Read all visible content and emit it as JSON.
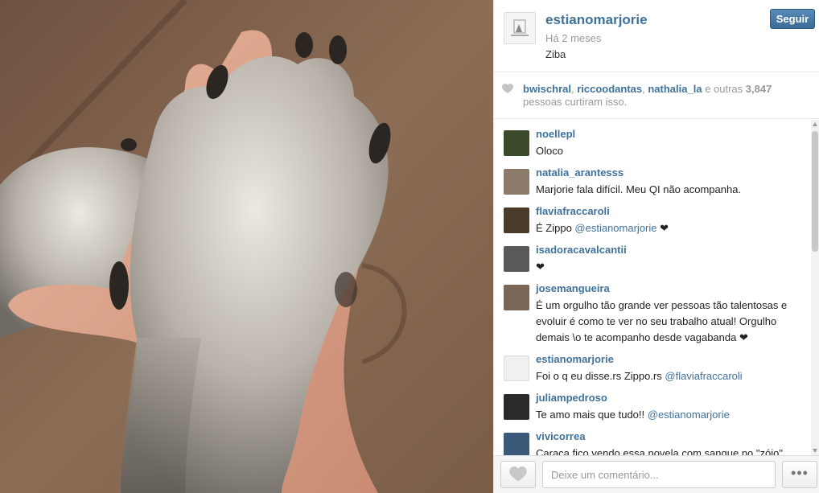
{
  "post": {
    "username": "estianomarjorie",
    "time": "Há 2 meses",
    "caption": "Ziba",
    "follow_label": "Seguir"
  },
  "likes": {
    "users": [
      "bwischral",
      "riccoodantas",
      "nathalia_la"
    ],
    "connector": "e outras",
    "count": "3,847",
    "suffix": "pessoas curtiram isso."
  },
  "comments": [
    {
      "user": "noellepl",
      "text": "Oloco ",
      "mention": "",
      "after": "",
      "avatar_color": "#3c4a2c"
    },
    {
      "user": "natalia_arantesss",
      "text": "Marjorie fala difícil. Meu QI não acompanha. ",
      "mention": "",
      "after": "",
      "avatar_color": "#8c7a6a"
    },
    {
      "user": "flaviafraccaroli",
      "text": "É Zippo ",
      "mention": "@estianomarjorie",
      "after": " ❤",
      "avatar_color": "#4a3b2a"
    },
    {
      "user": "isadoracavalcantii",
      "text": "❤",
      "mention": "",
      "after": "",
      "avatar_color": "#5a5a5a"
    },
    {
      "user": "josemangueira",
      "text": "É um orgulho tão grande ver pessoas tão talentosas e evoluir é como te ver no seu trabalho atual! Orgulho demais \\o te acompanho desde vagabanda ❤",
      "mention": "",
      "after": "",
      "avatar_color": "#7a6655"
    },
    {
      "user": "estianomarjorie",
      "text": "Foi o q eu disse.rs Zippo.rs ",
      "mention": "@flaviafraccaroli",
      "after": "",
      "avatar_color": "#eeeeee"
    },
    {
      "user": "juliampedroso",
      "text": "Te amo mais que tudo!! ",
      "mention": "@estianomarjorie",
      "after": "",
      "avatar_color": "#2a2a2a"
    },
    {
      "user": "vivicorrea",
      "text": "Caraca fico vendo essa novela com sangue no \"zóio\"",
      "mention": "",
      "after": "",
      "avatar_color": "#3a5a7a"
    }
  ],
  "footer": {
    "comment_placeholder": "Deixe um comentário...",
    "more_label": "•••"
  },
  "colors": {
    "link": "#3f729b",
    "follow_button": "#3b6b97",
    "muted": "#999999"
  },
  "icons": {
    "like": "heart-icon",
    "more": "more-dots-icon"
  }
}
